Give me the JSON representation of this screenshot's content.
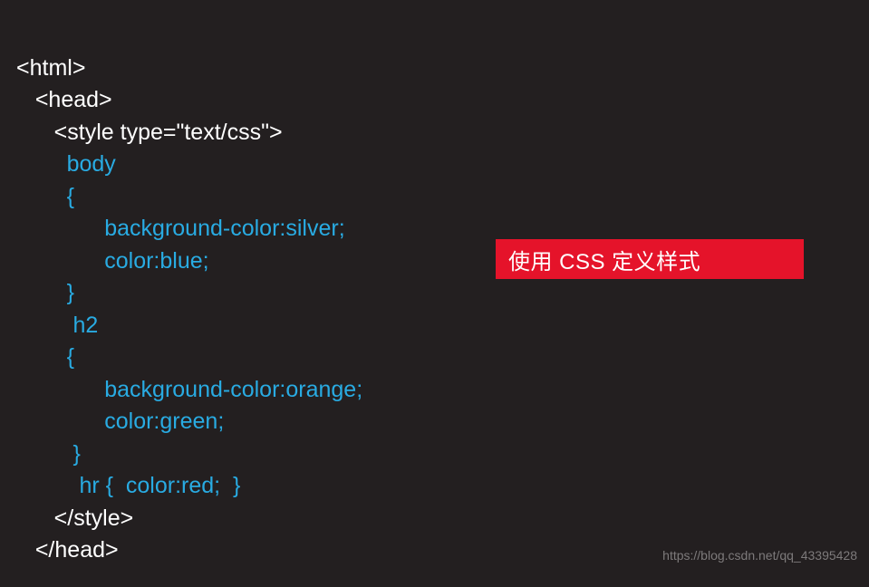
{
  "code": {
    "l1": "<html>",
    "l2": "   <head>",
    "l3_a": "      <style type=",
    "l3_b": "\"text/css\"",
    "l3_c": ">",
    "l4": "        body",
    "l5": "        {",
    "l6": "              background-color:silver;",
    "l7": "              color:blue;",
    "l8": "        }",
    "l9": "         h2",
    "l10": "        {",
    "l11": "              background-color:orange;",
    "l12": "              color:green;",
    "l13": "         }",
    "l14_a": "          hr ",
    "l14_b": "{",
    "l14_c": "  color:red;  ",
    "l14_d": "}",
    "l15": "      </style>",
    "l16": "   </head>"
  },
  "label": "使用 CSS 定义样式",
  "watermark": "https://blog.csdn.net/qq_43395428"
}
